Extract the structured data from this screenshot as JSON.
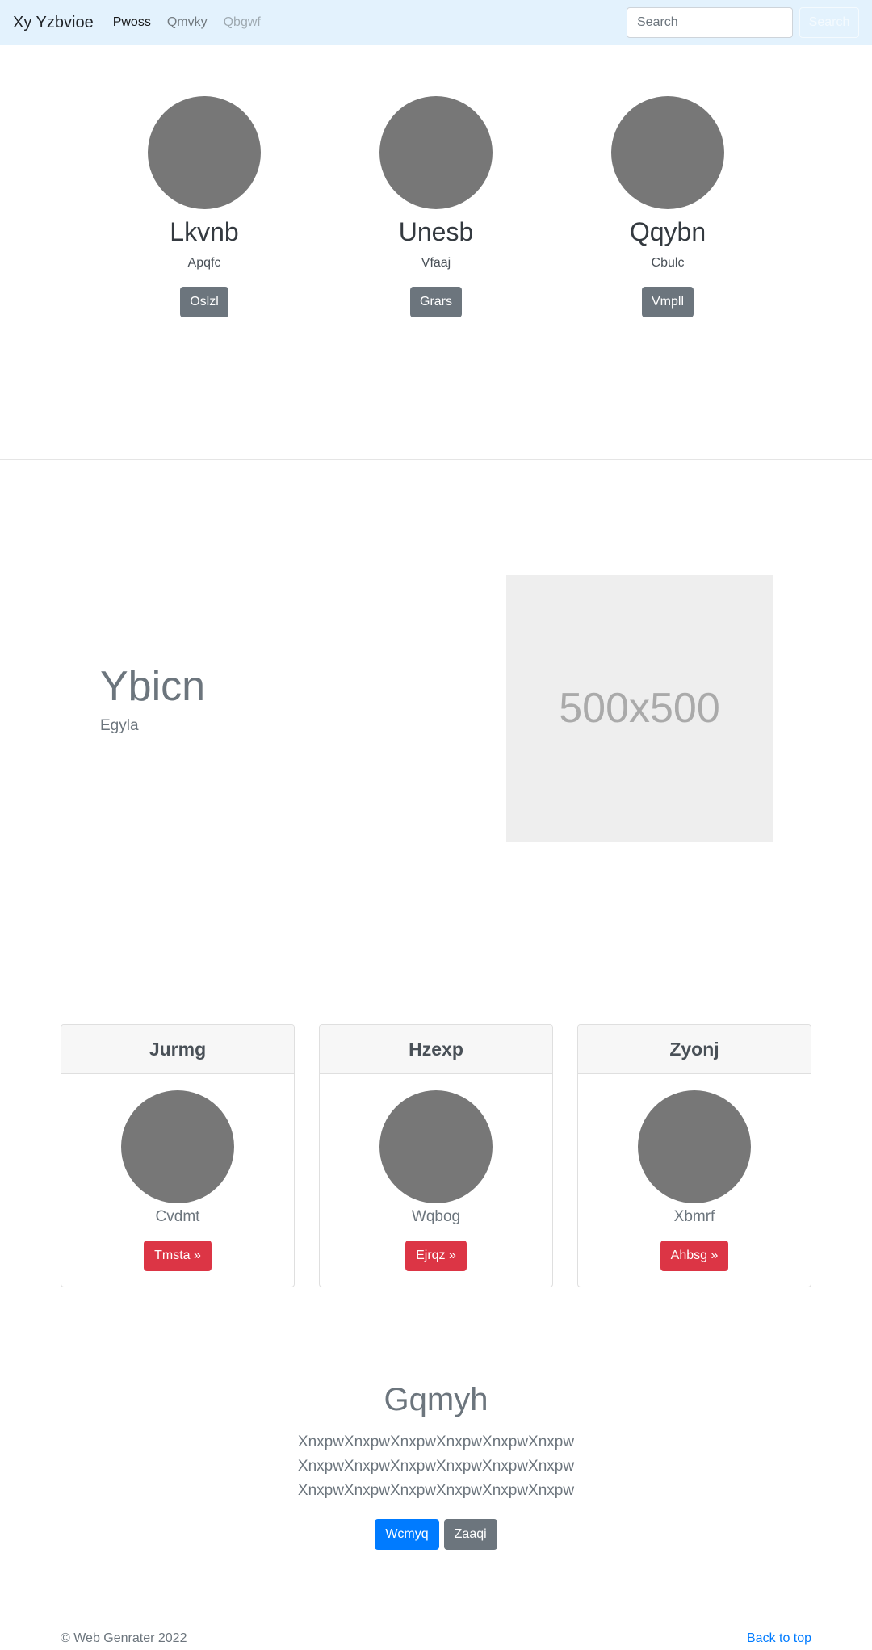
{
  "navbar": {
    "brand": "Xy Yzbvioe",
    "links": [
      {
        "label": "Pwoss",
        "state": "active"
      },
      {
        "label": "Qmvky",
        "state": "normal"
      },
      {
        "label": "Qbgwf",
        "state": "disabled"
      }
    ],
    "search_placeholder": "Search",
    "search_button": "Search"
  },
  "team": [
    {
      "name": "Lkvnb",
      "role": "Apqfc",
      "button": "Oslzl"
    },
    {
      "name": "Unesb",
      "role": "Vfaaj",
      "button": "Grars"
    },
    {
      "name": "Qqybn",
      "role": "Cbulc",
      "button": "Vmpll"
    }
  ],
  "feature": {
    "heading": "Ybicn",
    "subheading": "Egyla",
    "image_label": "500x500"
  },
  "cards": [
    {
      "title": "Jurmg",
      "text": "Cvdmt",
      "button": "Tmsta »"
    },
    {
      "title": "Hzexp",
      "text": "Wqbog",
      "button": "Ejrqz »"
    },
    {
      "title": "Zyonj",
      "text": "Xbmrf",
      "button": "Ahbsg »"
    }
  ],
  "jumbotron": {
    "title": "Gqmyh",
    "lines": [
      "XnxpwXnxpwXnxpwXnxpwXnxpwXnxpw",
      "XnxpwXnxpwXnxpwXnxpwXnxpwXnxpw",
      "XnxpwXnxpwXnxpwXnxpwXnxpwXnxpw"
    ],
    "primary_button": "Wcmyq",
    "secondary_button": "Zaaqi"
  },
  "footer": {
    "copyright": "© Web Genrater 2022",
    "back_to_top": "Back to top"
  },
  "colors": {
    "navbar_bg": "#e3f2fd",
    "secondary": "#6c757d",
    "danger": "#dc3545",
    "primary": "#007bff",
    "avatar": "#777777"
  }
}
